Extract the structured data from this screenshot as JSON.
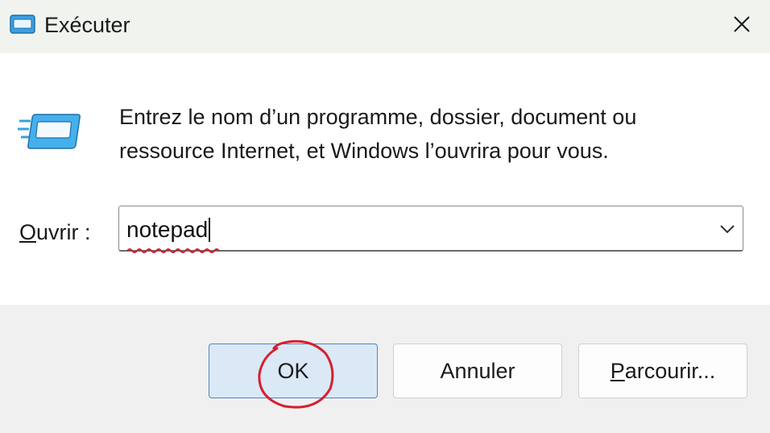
{
  "window": {
    "title": "Exécuter",
    "title_icon": "run-dialog-icon",
    "close_icon": "close-icon"
  },
  "body": {
    "app_icon": "run-dialog-icon",
    "description_line1": "Entrez le nom d’un programme, dossier, document ou",
    "description_line2": "ressource Internet, et Windows l’ouvrira pour vous."
  },
  "open_field": {
    "label_accel": "O",
    "label_rest": "uvrir :",
    "value": "notepad",
    "dropdown_icon": "chevron-down-icon"
  },
  "buttons": {
    "ok_label": "OK",
    "cancel_label": "Annuler",
    "browse_accel": "P",
    "browse_rest": "arcourir..."
  },
  "colors": {
    "titlebar_bg": "#f0f3ee",
    "footer_bg": "#f0f0f0",
    "ok_button_bg": "#dbe8f5",
    "ok_button_border": "#4a86c4",
    "annotation_red": "#d42030",
    "icon_blue": "#3aa0e0"
  }
}
